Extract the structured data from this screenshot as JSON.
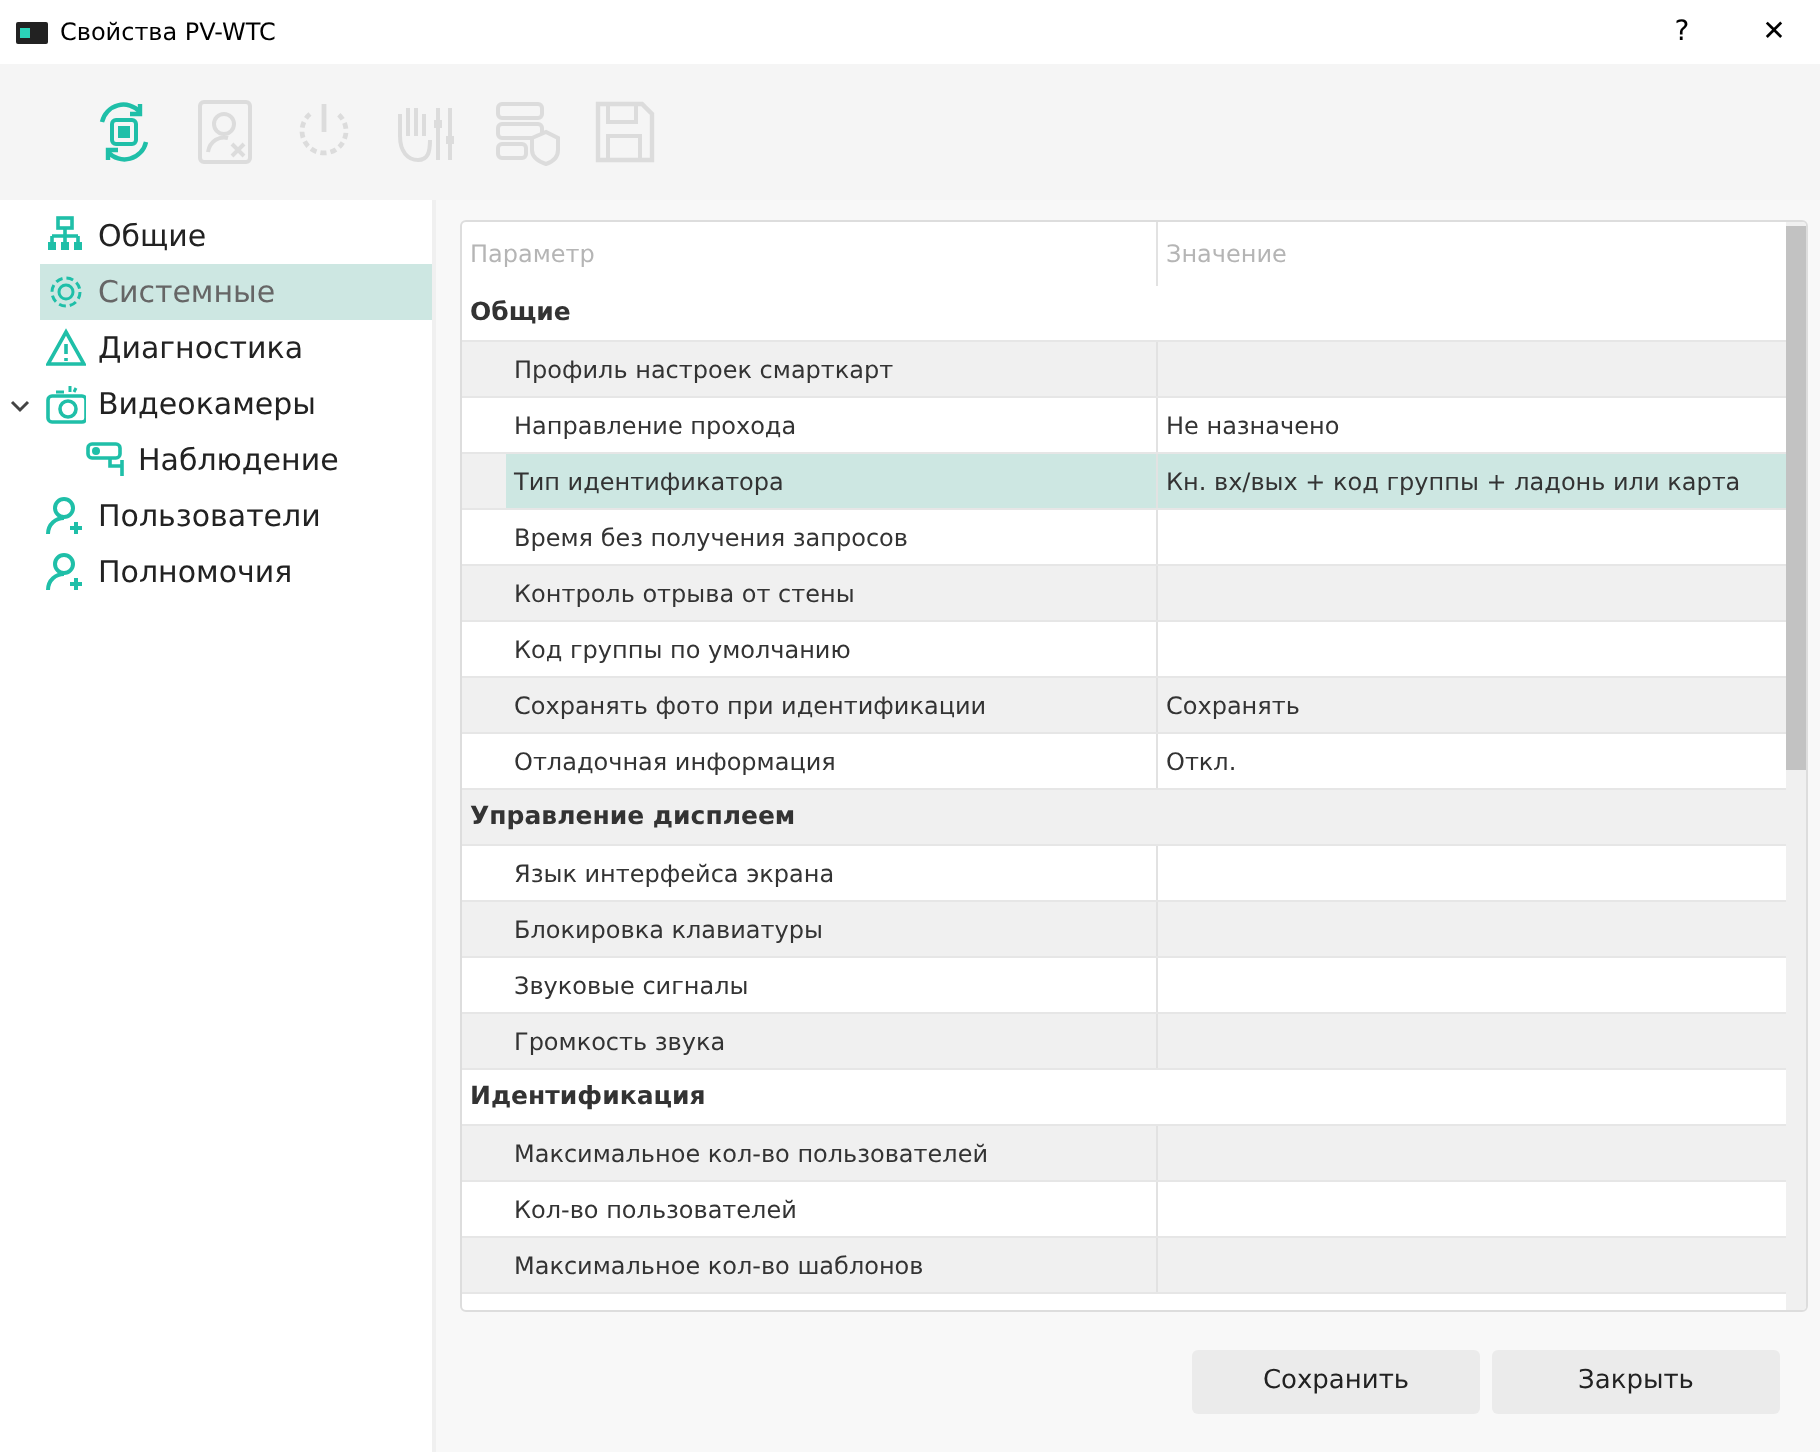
{
  "window": {
    "title": "Свойства PV-WTC",
    "help": "?",
    "close": "✕"
  },
  "toolbar": [
    {
      "kind": "sync",
      "disabled": false
    },
    {
      "kind": "contact",
      "disabled": true
    },
    {
      "kind": "power",
      "disabled": true
    },
    {
      "kind": "hand",
      "disabled": true
    },
    {
      "kind": "server",
      "disabled": true
    },
    {
      "kind": "save",
      "disabled": true
    }
  ],
  "sidebar": {
    "items": [
      {
        "label": "Общие",
        "kind": "network",
        "selected": false
      },
      {
        "label": "Системные",
        "kind": "gear",
        "selected": true
      },
      {
        "label": "Диагностика",
        "kind": "warning",
        "selected": false
      },
      {
        "label": "Видеокамеры",
        "kind": "camera",
        "selected": false,
        "expanded": true,
        "children": [
          {
            "label": "Наблюдение",
            "kind": "cctv",
            "selected": false
          }
        ]
      },
      {
        "label": "Пользователи",
        "kind": "user",
        "selected": false
      },
      {
        "label": "Полномочия",
        "kind": "user",
        "selected": false
      }
    ]
  },
  "table": {
    "columns": [
      "Параметр",
      "Значение"
    ],
    "rows": [
      {
        "kind": "group",
        "label": "Общие"
      },
      {
        "kind": "item",
        "label": "Профиль настроек смарткарт",
        "selected": false
      },
      {
        "kind": "item",
        "label": "Направление прохода",
        "value": "Не назначено",
        "selected": false
      },
      {
        "kind": "item",
        "label": "Тип идентификатора",
        "value": "Кн. вх/вых + код группы + ладонь или карта",
        "selected": true
      },
      {
        "kind": "item",
        "label": "Время без получения запросов",
        "selected": false
      },
      {
        "kind": "item",
        "label": "Контроль отрыва от стены",
        "selected": false
      },
      {
        "kind": "item",
        "label": "Код группы по умолчанию",
        "selected": false
      },
      {
        "kind": "item",
        "label": "Сохранять фото при идентификации",
        "value": "Сохранять",
        "selected": false
      },
      {
        "kind": "item",
        "label": "Отладочная информация",
        "value": "Откл.",
        "selected": false
      },
      {
        "kind": "group",
        "label": "Управление дисплеем"
      },
      {
        "kind": "item",
        "label": "Язык интерфейса экрана",
        "selected": false
      },
      {
        "kind": "item",
        "label": "Блокировка клавиатуры",
        "selected": false
      },
      {
        "kind": "item",
        "label": "Звуковые сигналы",
        "selected": false
      },
      {
        "kind": "item",
        "label": "Громкость звука",
        "selected": false
      },
      {
        "kind": "group",
        "label": "Идентификация"
      },
      {
        "kind": "item",
        "label": "Максимальное кол-во пользователей",
        "selected": false
      },
      {
        "kind": "item",
        "label": "Кол-во пользователей",
        "selected": false
      },
      {
        "kind": "item",
        "label": "Максимальное кол-во шаблонов",
        "selected": false
      }
    ]
  },
  "buttons": [
    "Сохранить",
    "Закрыть"
  ]
}
